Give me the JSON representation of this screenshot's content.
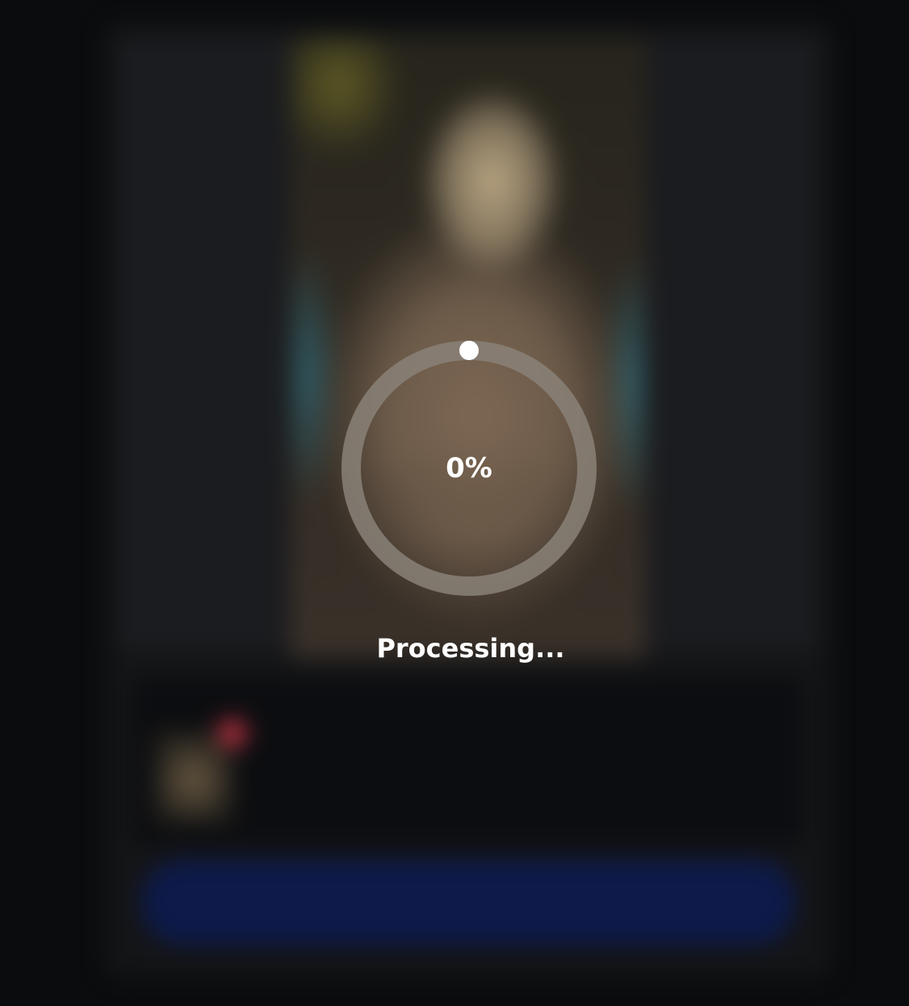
{
  "progress": {
    "percent_label": "0%",
    "status_label": "Processing...",
    "value": 0
  },
  "colors": {
    "background": "#0b0c0e",
    "ring": "#8a8178",
    "text": "#ffffff",
    "button": "#0d1a4a",
    "badge": "#b4303f"
  }
}
